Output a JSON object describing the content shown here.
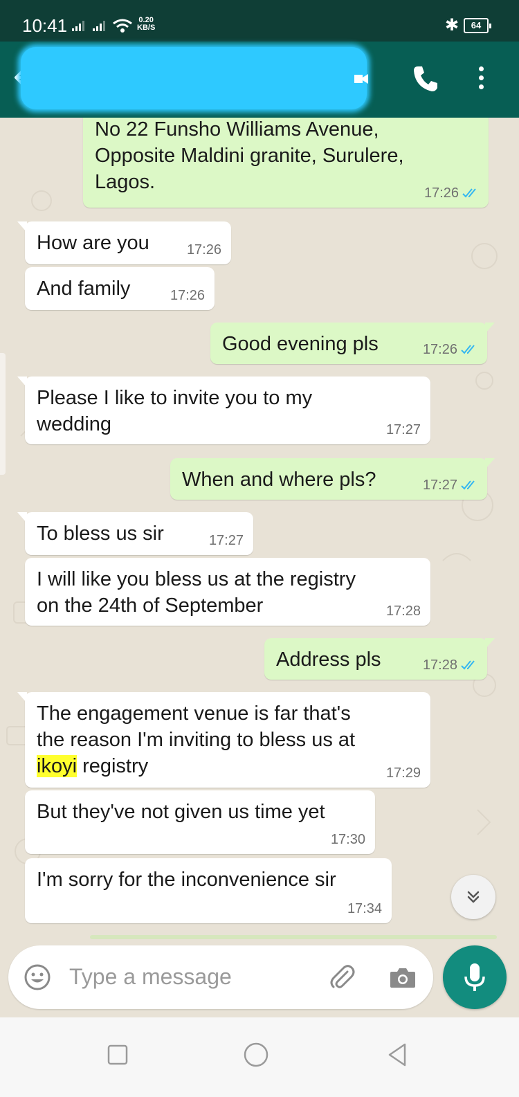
{
  "status_bar": {
    "time": "10:41",
    "net_speed_value": "0.20",
    "net_speed_unit": "KB/S",
    "battery": "64"
  },
  "header": {
    "contact_name": ""
  },
  "messages": [
    {
      "dir": "out",
      "lines": [
        "No 22 Funsho Williams Avenue,",
        "Opposite Maldini granite, Surulere,",
        "Lagos."
      ],
      "time": "17:26",
      "read": true
    },
    {
      "dir": "in",
      "lines": [
        "How are you"
      ],
      "time": "17:26"
    },
    {
      "dir": "in",
      "lines": [
        "And family"
      ],
      "time": "17:26"
    },
    {
      "dir": "out",
      "lines": [
        "Good evening pls"
      ],
      "time": "17:26",
      "read": true
    },
    {
      "dir": "in",
      "lines": [
        "Please I like to invite you to my",
        "wedding"
      ],
      "time": "17:27"
    },
    {
      "dir": "out",
      "lines": [
        "When and where pls?"
      ],
      "time": "17:27",
      "read": true
    },
    {
      "dir": "in",
      "lines": [
        "To bless us sir"
      ],
      "time": "17:27"
    },
    {
      "dir": "in",
      "lines": [
        "I will like you bless us at the registry",
        "on the 24th of September"
      ],
      "time": "17:28"
    },
    {
      "dir": "out",
      "lines": [
        "Address pls"
      ],
      "time": "17:28",
      "read": true
    },
    {
      "dir": "in",
      "lines": [
        "The engagement venue is far that's",
        "the reason I'm inviting to bless us at"
      ],
      "highlight_word": "ikoyi",
      "highlight_rest": " registry",
      "time": "17:29"
    },
    {
      "dir": "in",
      "lines": [
        "But they've not given us time yet"
      ],
      "time": "17:30"
    },
    {
      "dir": "in",
      "lines": [
        "I'm sorry for the inconvenience sir"
      ],
      "time": "17:34"
    }
  ],
  "input": {
    "placeholder": "Type a message"
  },
  "colors": {
    "header": "#075e54",
    "status_bar": "#0f3e36",
    "outgoing_bubble": "#dcf8c6",
    "incoming_bubble": "#ffffff",
    "read_ticks": "#34b7f1",
    "mic_button": "#128c7e",
    "highlight": "#ffff2e"
  },
  "icons": [
    "back-arrow-icon",
    "video-call-icon",
    "phone-icon",
    "more-vertical-icon",
    "emoji-icon",
    "paperclip-icon",
    "camera-icon",
    "microphone-icon",
    "double-chevron-down-icon",
    "square-nav-icon",
    "circle-nav-icon",
    "triangle-back-nav-icon",
    "bluetooth-icon",
    "wifi-icon",
    "battery-icon",
    "signal-icon"
  ]
}
